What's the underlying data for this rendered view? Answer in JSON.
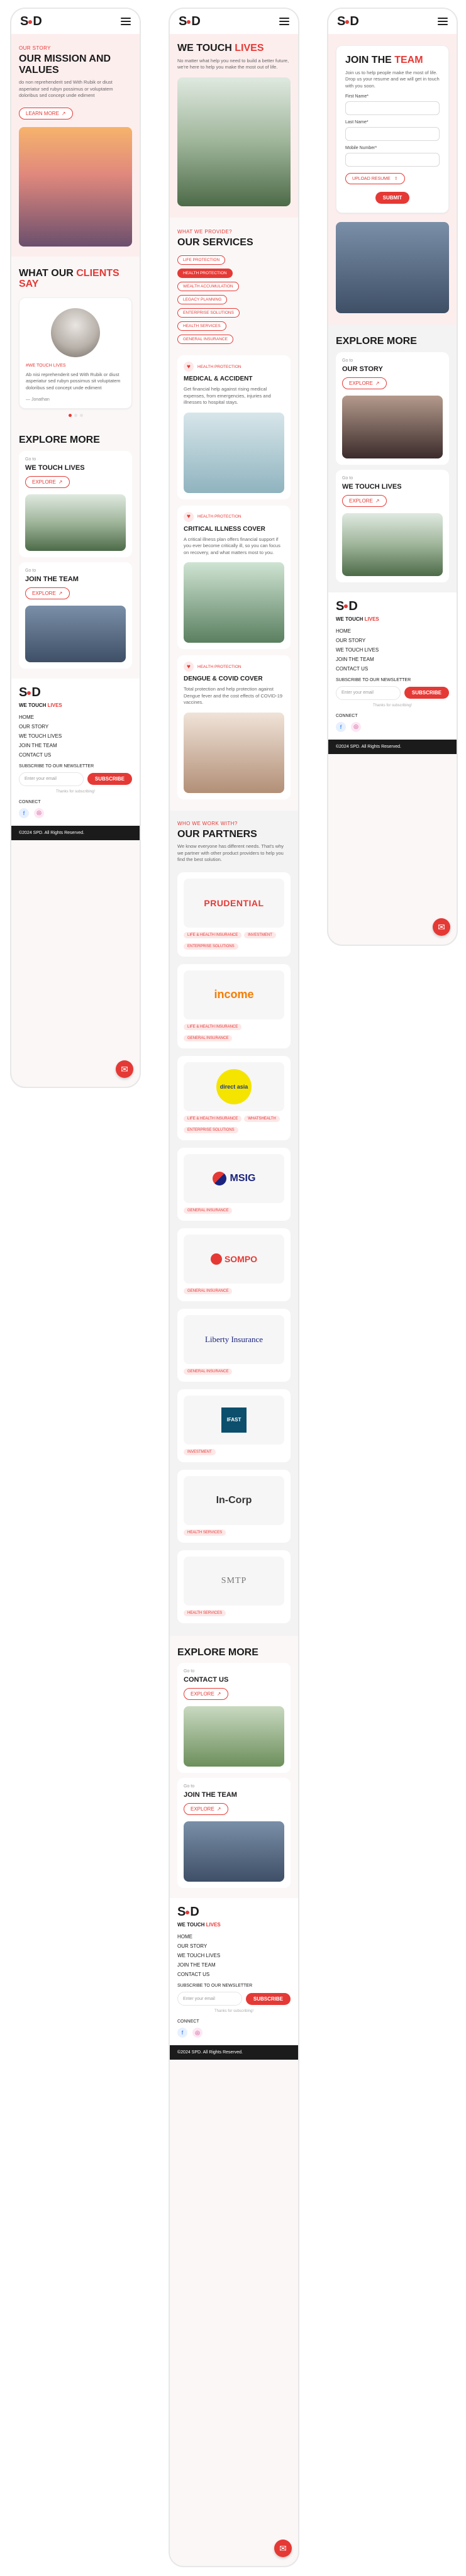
{
  "brand": {
    "logo": "SPD"
  },
  "accent": "#e53935",
  "p1": {
    "our_story": {
      "kicker": "OUR STORY",
      "title": "OUR MISSION AND VALUES",
      "body": "do non reprehenderit sed With Rubik or diust asperiatur sed rubyn possimus or voluptatem doloribus sed concept unde ediment",
      "cta": "LEARN MORE"
    },
    "clients": {
      "title_a": "WHAT OUR ",
      "title_b": "CLIENTS",
      "title_c": " SAY",
      "tag": "#WE TOUCH LIVES",
      "quote": "Ab nisi reprehenderit sed With Rubik or diust asperiatur sed rubyn possimus sit voluptatem doloribus sed concept unde ediment",
      "author": "— Jonathan"
    },
    "explore": {
      "title": "EXPLORE MORE",
      "items": [
        {
          "goto": "Go to",
          "title": "WE TOUCH LIVES",
          "cta": "EXPLORE"
        },
        {
          "goto": "Go to",
          "title": "JOIN THE TEAM",
          "cta": "EXPLORE"
        }
      ]
    }
  },
  "p2": {
    "hero": {
      "title_a": "WE TOUCH ",
      "title_b": "LIVES",
      "body": "No matter what help you need to build a better future, we're here to help you make the most out of life."
    },
    "services": {
      "kicker": "WHAT WE PROVIDE?",
      "title": "OUR SERVICES",
      "chips": [
        "LIFE PROTECTION",
        "HEALTH PROTECTION",
        "WEALTH ACCUMULATION",
        "LEGACY PLANNING",
        "ENTERPRISE SOLUTIONS",
        "HEALTH SERVICES",
        "GENERAL INSURANCE"
      ],
      "active_index": 1,
      "cards": [
        {
          "kicker": "HEALTH PROTECTION",
          "title": "MEDICAL & ACCIDENT",
          "body": "Get financial help against rising medical expenses, from emergencies, injuries and illnesses to hospital stays."
        },
        {
          "kicker": "HEALTH PROTECTION",
          "title": "CRITICAL ILLNESS COVER",
          "body": "A critical illness plan offers financial support if you ever become critically ill, so you can focus on recovery, and what matters most to you."
        },
        {
          "kicker": "HEALTH PROTECTION",
          "title": "DENGUE & COVID COVER",
          "body": "Total protection and help protection against Dengue fever and the cost effects of COVID-19 vaccines."
        }
      ]
    },
    "partners": {
      "kicker": "WHO WE WORK WITH?",
      "title": "OUR PARTNERS",
      "body": "We know everyone has different needs. That's why we partner with other product providers to help you find the best solution.",
      "items": [
        {
          "logo": "PRUDENTIAL",
          "tags": [
            "LIFE & HEALTH INSURANCE",
            "INVESTMENT",
            "ENTERPRISE SOLUTIONS"
          ]
        },
        {
          "logo": "income",
          "tags": [
            "LIFE & HEALTH INSURANCE",
            "GENERAL INSURANCE"
          ]
        },
        {
          "logo": "direct asia",
          "tags": [
            "LIFE & HEALTH INSURANCE",
            "WHATSHEALTH",
            "ENTERPRISE SOLUTIONS"
          ]
        },
        {
          "logo": "MSIG",
          "tags": [
            "GENERAL INSURANCE"
          ]
        },
        {
          "logo": "SOMPO",
          "tags": [
            "GENERAL INSURANCE"
          ]
        },
        {
          "logo": "Liberty Insurance",
          "tags": [
            "GENERAL INSURANCE"
          ]
        },
        {
          "logo": "IFAST",
          "tags": [
            "INVESTMENT"
          ]
        },
        {
          "logo": "In-Corp",
          "tags": [
            "HEALTH SERVICES"
          ]
        },
        {
          "logo": "SMTP",
          "tags": [
            "HEALTH SERVICES"
          ]
        }
      ]
    },
    "explore": {
      "title": "EXPLORE MORE",
      "items": [
        {
          "goto": "Go to",
          "title": "CONTACT US",
          "cta": "EXPLORE"
        },
        {
          "goto": "Go to",
          "title": "JOIN THE TEAM",
          "cta": "EXPLORE"
        }
      ]
    }
  },
  "p3": {
    "join": {
      "title_a": "JOIN THE ",
      "title_b": "TEAM",
      "body": "Join us to help people make the most of life. Drop us your resume and we will get in touch with you soon.",
      "labels": [
        "First Name*",
        "Last Name*",
        "Mobile Number*"
      ],
      "upload": "UPLOAD RESUME",
      "submit": "SUBMIT"
    },
    "explore": {
      "title": "EXPLORE MORE",
      "items": [
        {
          "goto": "Go to",
          "title": "OUR STORY",
          "cta": "EXPLORE"
        },
        {
          "goto": "Go to",
          "title": "WE TOUCH LIVES",
          "cta": "EXPLORE"
        }
      ]
    }
  },
  "footer": {
    "tag_a": "WE TOUCH ",
    "tag_b": "LIVES",
    "links": [
      "HOME",
      "OUR STORY",
      "WE TOUCH LIVES",
      "JOIN THE TEAM",
      "CONTACT US"
    ],
    "newsletter": "SUBSCRIBE TO OUR NEWSLETTER",
    "placeholder": "Enter your email",
    "subscribe": "SUBSCRIBE",
    "note": "Thanks for subscribing!",
    "connect": "CONNECT",
    "copyright": "©2024 SPD. All Rights Reserved."
  }
}
